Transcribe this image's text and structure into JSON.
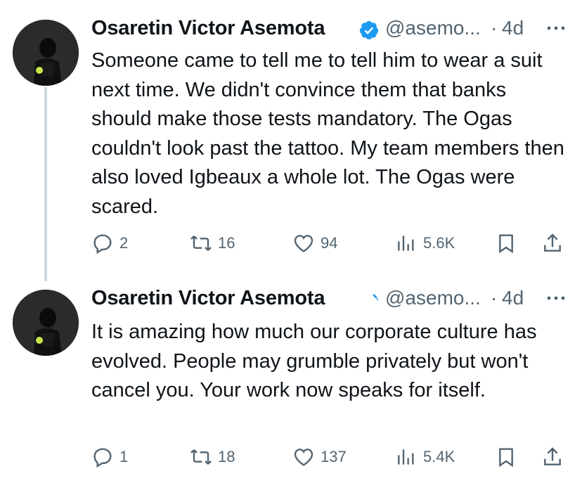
{
  "tweets": [
    {
      "author_name": "Osaretin Victor Asemota",
      "handle": "@asemo...",
      "separator": "·",
      "time": "4d",
      "text": "Someone came to tell me to tell him to wear a suit next time. We didn't convince them that banks should make those tests mandatory. The Ogas couldn't look past the tattoo. My team members then also loved Igbeaux a whole lot. The Ogas were scared.",
      "replies": "2",
      "reposts": "16",
      "likes": "94",
      "views": "5.6K"
    },
    {
      "author_name": "Osaretin Victor Asemota",
      "handle": "@asemo...",
      "separator": "·",
      "time": "4d",
      "text": "It is amazing how much our corporate culture has evolved. People may grumble privately but won't cancel you. Your work now speaks for itself.",
      "replies": "1",
      "reposts": "18",
      "likes": "137",
      "views": "5.4K"
    }
  ],
  "colors": {
    "text": "#0f1419",
    "secondary": "#536471",
    "verified_blue": "#1d9bf0",
    "thread_line": "#cfd9de"
  },
  "icons": [
    "reply-icon",
    "repost-icon",
    "like-icon",
    "views-icon",
    "bookmark-icon",
    "share-icon",
    "more-icon",
    "verified-badge-icon"
  ]
}
